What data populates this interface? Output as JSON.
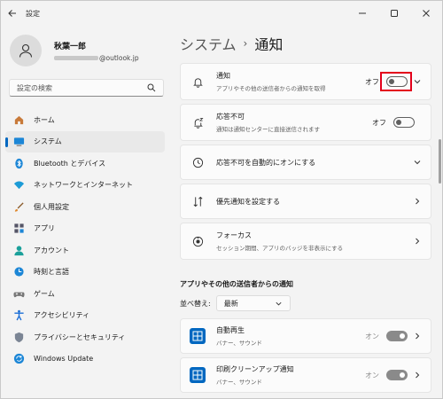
{
  "window": {
    "title": "設定"
  },
  "profile": {
    "name": "秋葉一郎",
    "email_suffix": "@outlook.jp"
  },
  "search": {
    "placeholder": "設定の検索"
  },
  "nav": {
    "items": [
      {
        "label": "ホーム",
        "icon": "home-icon"
      },
      {
        "label": "システム",
        "icon": "system-icon",
        "active": true
      },
      {
        "label": "Bluetooth とデバイス",
        "icon": "bluetooth-icon"
      },
      {
        "label": "ネットワークとインターネット",
        "icon": "network-icon"
      },
      {
        "label": "個人用設定",
        "icon": "personalize-icon"
      },
      {
        "label": "アプリ",
        "icon": "apps-icon"
      },
      {
        "label": "アカウント",
        "icon": "account-icon"
      },
      {
        "label": "時刻と言語",
        "icon": "time-icon"
      },
      {
        "label": "ゲーム",
        "icon": "gaming-icon"
      },
      {
        "label": "アクセシビリティ",
        "icon": "accessibility-icon"
      },
      {
        "label": "プライバシーとセキュリティ",
        "icon": "shield-icon"
      },
      {
        "label": "Windows Update",
        "icon": "update-icon"
      }
    ]
  },
  "breadcrumb": {
    "parent": "システム",
    "separator": "›",
    "current": "通知"
  },
  "cards": {
    "notifications": {
      "title": "通知",
      "subtitle": "アプリやその他の送信者からの通知を取得",
      "state": "オフ"
    },
    "dnd": {
      "title": "応答不可",
      "subtitle": "通知は通知センターに直接送信されます",
      "state": "オフ"
    },
    "auto_dnd": {
      "title": "応答不可を自動的にオンにする"
    },
    "priority": {
      "title": "優先通知を設定する"
    },
    "focus": {
      "title": "フォーカス",
      "subtitle": "セッション期間、アプリのバッジを非表示にする"
    }
  },
  "apps_section": {
    "title": "アプリやその他の送信者からの通知",
    "sort_label": "並べ替え:",
    "sort_value": "最新",
    "apps": [
      {
        "title": "自動再生",
        "subtitle": "バナー、サウンド",
        "state": "オン"
      },
      {
        "title": "印刷クリーンアップ通知",
        "subtitle": "バナー、サウンド",
        "state": "オン"
      }
    ]
  },
  "colors": {
    "accent": "#0067c0",
    "highlight": "#e3001b"
  }
}
